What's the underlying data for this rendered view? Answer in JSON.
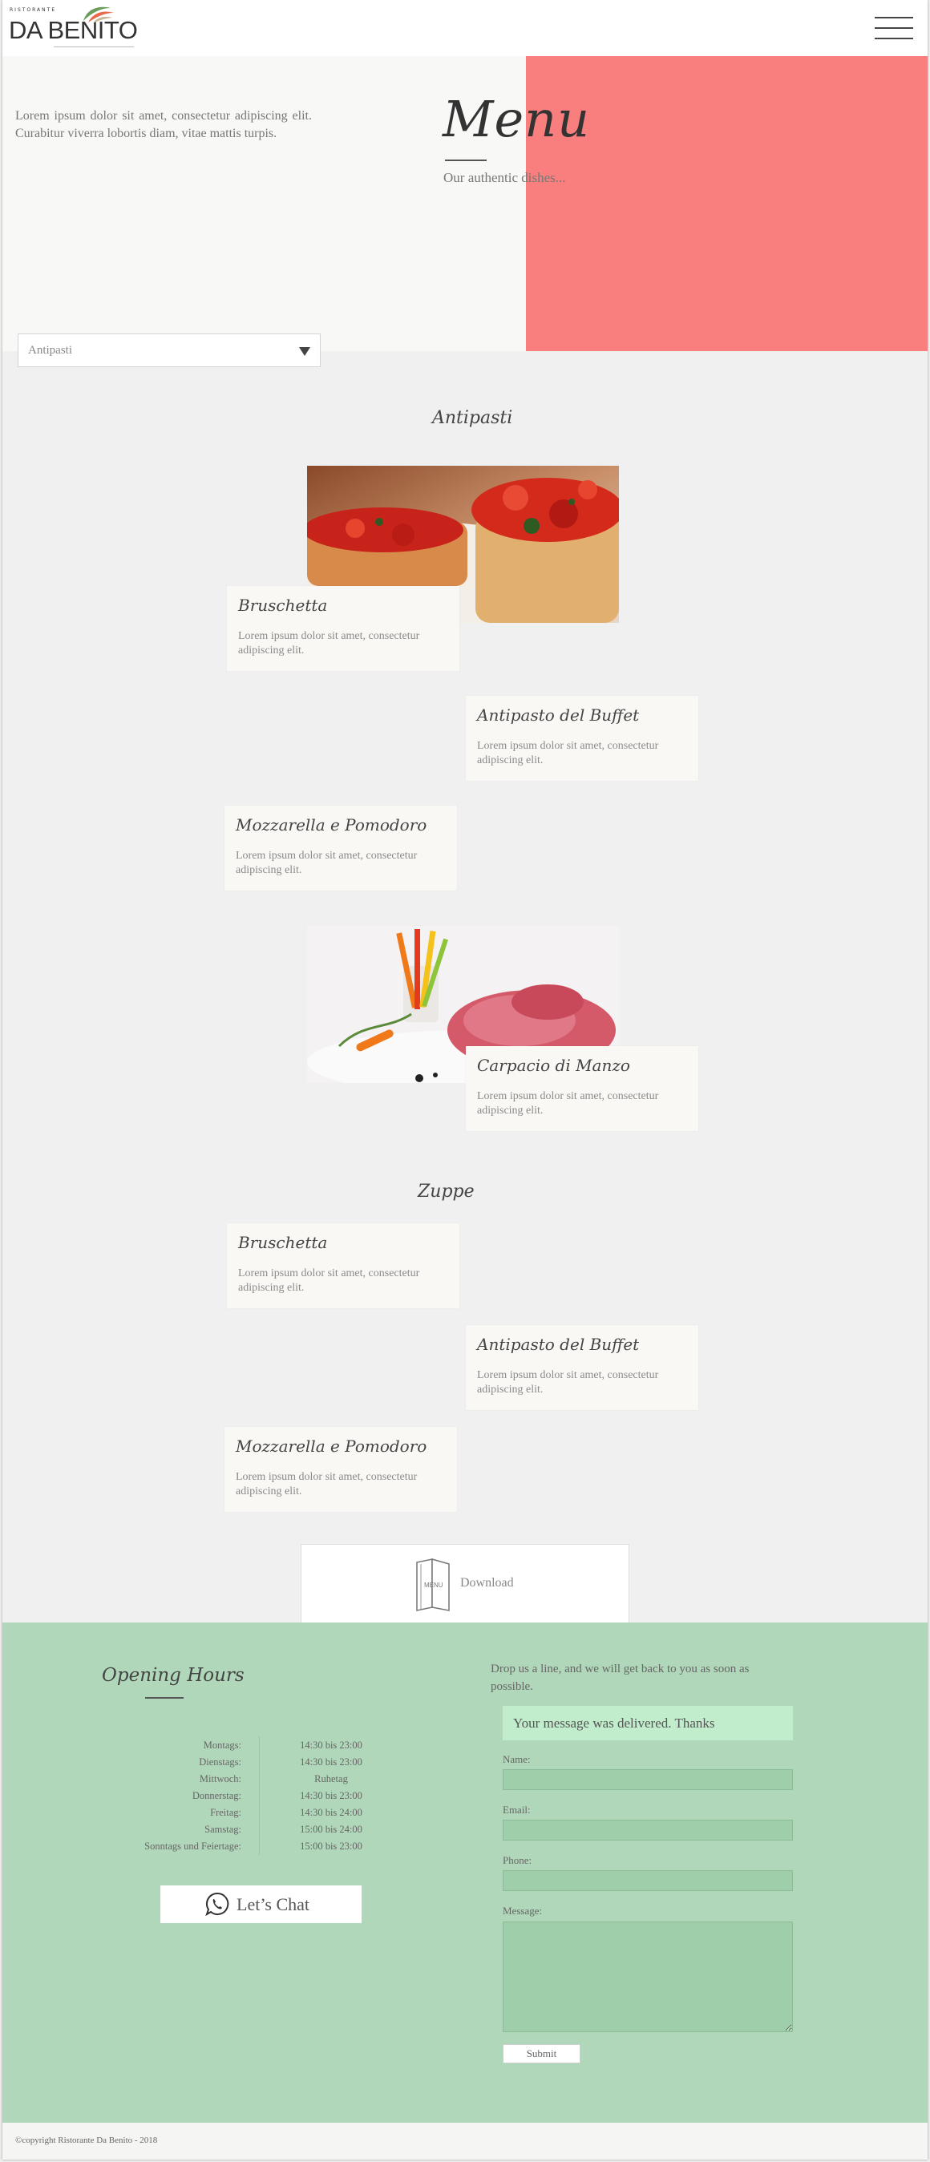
{
  "header": {
    "logo_small": "RISTORANTE",
    "logo_big": "DA BENITO",
    "menu_icon": "hamburger-icon"
  },
  "hero": {
    "intro": "Lorem ipsum dolor sit amet, consectetur adipiscing elit. Curabitur viverra lobortis diam, vitae mattis turpis.",
    "title": "Menu",
    "subtitle": "Our authentic dishes...",
    "accent_color": "#f97f7e"
  },
  "category_select": {
    "value": "Antipasti",
    "icon": "triangle-down-icon"
  },
  "sections": [
    {
      "title": "Antipasti",
      "items": [
        {
          "name": "Bruschetta",
          "desc": "Lorem ipsum dolor sit amet, consectetur adipiscing elit."
        },
        {
          "name": "Antipasto del Buffet",
          "desc": "Lorem ipsum dolor sit amet, consectetur adipiscing elit."
        },
        {
          "name": "Mozzarella e Pomodoro",
          "desc": "Lorem ipsum dolor sit amet, consectetur adipiscing elit."
        },
        {
          "name": "Carpacio di Manzo",
          "desc": "Lorem ipsum dolor sit amet, consectetur adipiscing elit."
        }
      ]
    },
    {
      "title": "Zuppe",
      "items": [
        {
          "name": "Bruschetta",
          "desc": "Lorem ipsum dolor sit amet, consectetur adipiscing elit."
        },
        {
          "name": "Antipasto del Buffet",
          "desc": "Lorem ipsum dolor sit amet, consectetur adipiscing elit."
        },
        {
          "name": "Mozzarella e Pomodoro",
          "desc": "Lorem ipsum dolor sit amet, consectetur adipiscing elit."
        }
      ]
    }
  ],
  "download": {
    "label": "Download",
    "icon_text": "MENU",
    "icon": "menu-book-icon"
  },
  "opening_hours": {
    "title": "Opening Hours",
    "rows": [
      {
        "day": "Montags:",
        "time": "14:30 bis 23:00"
      },
      {
        "day": "Dienstags:",
        "time": "14:30 bis 23:00"
      },
      {
        "day": "Mittwoch:",
        "time": "Ruhetag"
      },
      {
        "day": "Donnerstag:",
        "time": "14:30 bis 23:00"
      },
      {
        "day": "Freitag:",
        "time": "14:30 bis 24:00"
      },
      {
        "day": "Samstag:",
        "time": "15:00 bis 24:00"
      },
      {
        "day": "Sonntags und Feiertage:",
        "time": "15:00 bis 23:00"
      }
    ]
  },
  "chat": {
    "label": "Let’s Chat",
    "icon": "whatsapp-icon"
  },
  "contact": {
    "intro": "Drop us a line, and we will get back to you as soon as possible.",
    "success": "Your message was delivered. Thanks",
    "name_label": "Name:",
    "email_label": "Email:",
    "phone_label": "Phone:",
    "message_label": "Message:",
    "submit": "Submit",
    "name_value": "",
    "email_value": "",
    "phone_value": "",
    "message_value": ""
  },
  "footer": {
    "copyright": "©copyright Ristorante Da Benito - 2018"
  },
  "colors": {
    "footer_bg": "#b0d7b9",
    "success_bg": "#c2edcc",
    "input_bg": "#9fcfaa"
  }
}
